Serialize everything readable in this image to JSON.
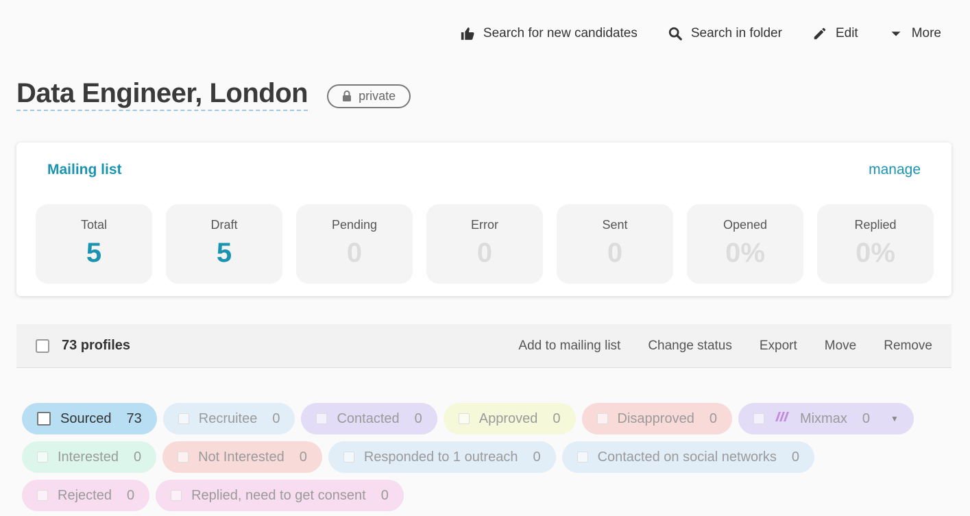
{
  "toolbar": {
    "search_candidates": "Search for new candidates",
    "search_folder": "Search in folder",
    "edit": "Edit",
    "more": "More"
  },
  "title": "Data Engineer, London",
  "badge": "private",
  "mailing": {
    "title": "Mailing list",
    "manage": "manage",
    "stats": [
      {
        "label": "Total",
        "value": "5",
        "active": true
      },
      {
        "label": "Draft",
        "value": "5",
        "active": true
      },
      {
        "label": "Pending",
        "value": "0",
        "active": false
      },
      {
        "label": "Error",
        "value": "0",
        "active": false
      },
      {
        "label": "Sent",
        "value": "0",
        "active": false
      },
      {
        "label": "Opened",
        "value": "0%",
        "active": false
      },
      {
        "label": "Replied",
        "value": "0%",
        "active": false
      }
    ]
  },
  "profiles": {
    "count": "73 profiles",
    "actions": [
      "Add to mailing list",
      "Change status",
      "Export",
      "Move",
      "Remove"
    ]
  },
  "statuses": [
    {
      "label": "Sourced",
      "count": "73",
      "color": "#b7def3",
      "active": true
    },
    {
      "label": "Recruitee",
      "count": "0",
      "color": "#e1eef8"
    },
    {
      "label": "Contacted",
      "count": "0",
      "color": "#e2dcf6"
    },
    {
      "label": "Approved",
      "count": "0",
      "color": "#f5f9da"
    },
    {
      "label": "Disapproved",
      "count": "0",
      "color": "#f8dbd9"
    },
    {
      "label": "Mixmax",
      "count": "0",
      "color": "#e2dcf6",
      "logo": true,
      "caret": true
    },
    {
      "label": "Interested",
      "count": "0",
      "color": "#dcf6ec"
    },
    {
      "label": "Not Interested",
      "count": "0",
      "color": "#f8dbd9"
    },
    {
      "label": "Responded to 1 outreach",
      "count": "0",
      "color": "#e1eef8"
    },
    {
      "label": "Contacted on social networks",
      "count": "0",
      "color": "#e1eef8"
    },
    {
      "label": "Rejected",
      "count": "0",
      "color": "#f8dcef"
    },
    {
      "label": "Replied, need to get consent",
      "count": "0",
      "color": "#f8dcef"
    }
  ]
}
